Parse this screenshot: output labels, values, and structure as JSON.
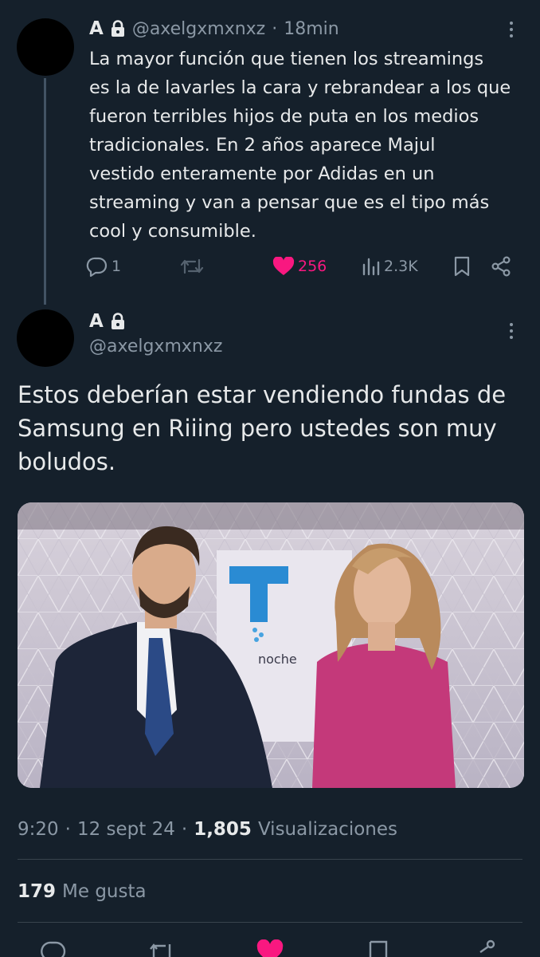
{
  "parent_tweet": {
    "display_name": "A",
    "handle": "@axelgxmxnxz",
    "separator": "·",
    "time_ago": "18min",
    "text": "La mayor función que tienen los streamings\nes la de lavarles la cara y rebrandear a los que\nfueron terribles hijos de puta en los medios\ntradicionales. En 2 años aparece Majul\nvestido enteramente por Adidas en un\nstreaming y van a pensar que es el tipo más\ncool y consumible.",
    "actions": {
      "replies": "1",
      "retweets": "",
      "likes": "256",
      "views": "2.3K"
    }
  },
  "main_tweet": {
    "display_name": "A",
    "handle": "@axelgxmxnxz",
    "text": "Estos deberían estar vendiendo fundas de\nSamsung en Riiing pero ustedes son muy\nboludos.",
    "media": {
      "description_icon": "photo-two-presenters",
      "logo_text": "noche"
    },
    "time": "9:20",
    "date": "12 sept 24",
    "views_count": "1,805",
    "views_label": "Visualizaciones",
    "likes_count": "179",
    "likes_label": "Me gusta"
  },
  "colors": {
    "background": "#15202b",
    "text": "#e7e9ea",
    "secondary": "#8b98a5",
    "like": "#f91880",
    "divider": "#38444d"
  }
}
